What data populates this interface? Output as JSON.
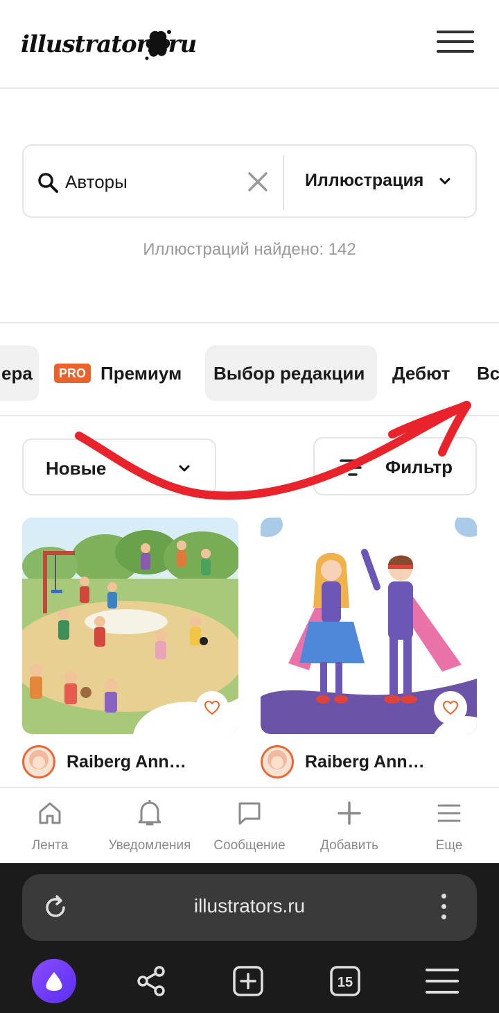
{
  "header": {
    "logo_text": "illustrators.ru",
    "menu_icon": "hamburger-icon"
  },
  "search": {
    "query": "Авторы",
    "type_label": "Иллюстрация",
    "results_text": "Иллюстраций найдено: 142"
  },
  "tabs": {
    "partial_left": "ера",
    "pro_badge": "PRO",
    "premium": "Премиум",
    "editors_choice": "Выбор редакции",
    "debut": "Дебют",
    "partial_right": "Вс"
  },
  "controls": {
    "sort_label": "Новые",
    "filter_label": "Фильтр"
  },
  "cards": [
    {
      "author": "Raiberg Ann…",
      "icon": "heart-outline-icon"
    },
    {
      "author": "Raiberg Ann…",
      "icon": "heart-outline-icon"
    }
  ],
  "bottom_nav": [
    {
      "label": "Лента",
      "icon": "home-icon"
    },
    {
      "label": "Уведомления",
      "icon": "bell-icon"
    },
    {
      "label": "Сообщение",
      "icon": "message-icon"
    },
    {
      "label": "Добавить",
      "icon": "plus-icon"
    },
    {
      "label": "Еще",
      "icon": "menu-icon"
    }
  ],
  "browser": {
    "url": "illustrators.ru",
    "tab_count": "15"
  },
  "colors": {
    "accent": "#e8622c",
    "annotation": "#e8232b",
    "browser_bg": "#1b1b1b"
  }
}
